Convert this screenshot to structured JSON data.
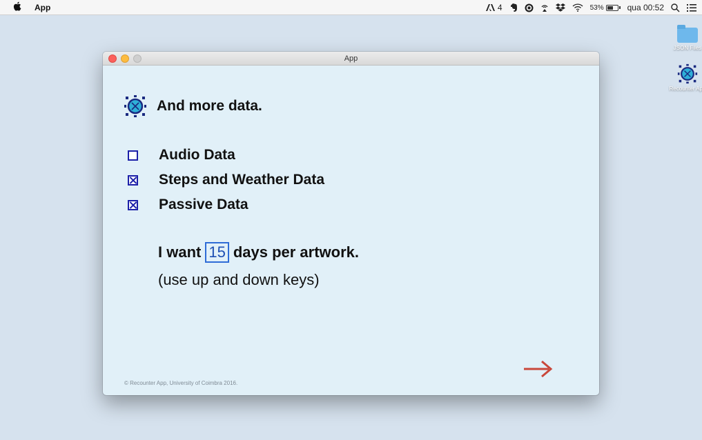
{
  "menubar": {
    "app_name": "App",
    "tray_adobe_count": "4",
    "tray_battery": "53%",
    "tray_clock": "qua 00:52"
  },
  "desktop": {
    "icons": [
      {
        "label": "JSON Files",
        "icon": "folder-icon"
      },
      {
        "label": "Recounter App",
        "icon": "recounter-logo-icon"
      }
    ]
  },
  "window": {
    "title": "App"
  },
  "main": {
    "heading": "And more data.",
    "options": [
      {
        "label": "Audio Data",
        "checked": false
      },
      {
        "label": "Steps and Weather Data",
        "checked": true
      },
      {
        "label": "Passive Data",
        "checked": true
      }
    ],
    "want_prefix": "I want",
    "days_value": "15",
    "want_suffix": "days per artwork.",
    "hint": "(use up and down keys)",
    "footer": "© Recounter App, University of Coimbra 2016."
  },
  "colors": {
    "accent": "#1b1fa8",
    "next_arrow": "#c9473a",
    "window_bg": "#e1f0f8"
  }
}
